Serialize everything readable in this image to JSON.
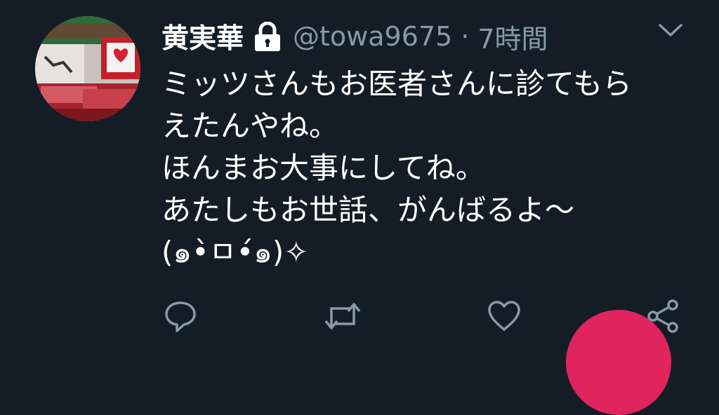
{
  "tweet": {
    "display_name": "黄実華",
    "handle": "@towa9675",
    "separator": "·",
    "timestamp": "7時間",
    "lines": [
      "ミッツさんもお医者さんに診てもら",
      "えたんやね。",
      "ほんまお大事にしてね。",
      "あたしもお世話、がんばるよ〜",
      "(๑•̀ㅁ•́๑)✧"
    ]
  },
  "icons": {
    "protected": "lock-icon",
    "menu": "chevron-down-icon",
    "reply": "reply-icon",
    "retweet": "retweet-icon",
    "like": "heart-icon",
    "share": "share-icon",
    "compose": "compose-fab"
  },
  "colors": {
    "background": "#141d26",
    "secondary_text": "#8899a6",
    "accent_fab": "#e0245e"
  }
}
